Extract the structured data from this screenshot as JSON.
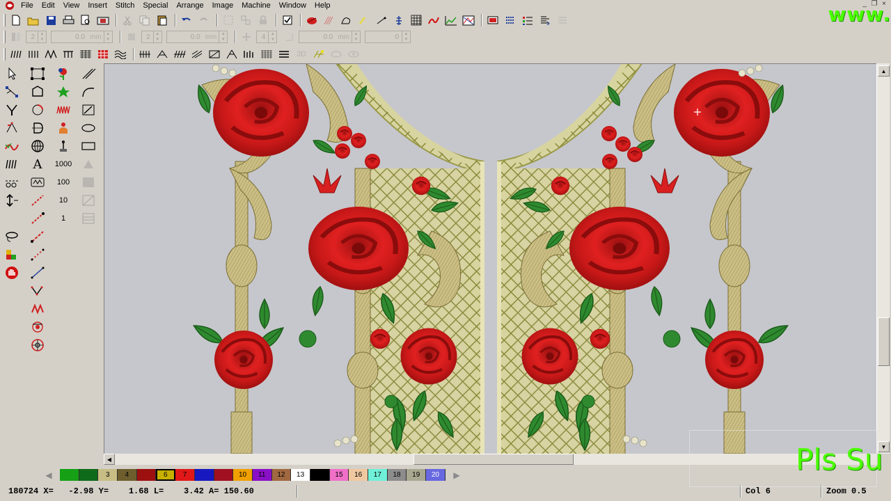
{
  "menubar": {
    "items": [
      "File",
      "Edit",
      "View",
      "Insert",
      "Stitch",
      "Special",
      "Arrange",
      "Image",
      "Machine",
      "Window",
      "Help"
    ],
    "window_controls": [
      "_",
      "❐",
      "×"
    ]
  },
  "watermarks": {
    "top": "www.",
    "bottom": "Pls Su"
  },
  "toolbar2": {
    "fields": [
      {
        "value": "0.0",
        "unit": "mm"
      },
      {
        "value": "0.0",
        "unit": "mm"
      },
      {
        "value": "0.0",
        "unit": "mm"
      },
      {
        "value": "0",
        "unit": ""
      }
    ],
    "small_values": [
      "2",
      "2",
      "4"
    ]
  },
  "toolbar3": {
    "label_3d": "3D"
  },
  "toolbox": {
    "text_tool": "A",
    "num_1000": "1000",
    "num_100": "100",
    "num_10": "10",
    "num_1": "1"
  },
  "colorbar": {
    "swatches": [
      {
        "label": "",
        "color": "#15a015",
        "fg": "#000"
      },
      {
        "label": "",
        "color": "#0f6a1a",
        "fg": "#000"
      },
      {
        "label": "3",
        "color": "#c8bd84",
        "fg": "#000"
      },
      {
        "label": "4",
        "color": "#6e5e2e",
        "fg": "#000"
      },
      {
        "label": "",
        "color": "#9c1010",
        "fg": "#000"
      },
      {
        "label": "6",
        "color": "#c8b000",
        "fg": "#000"
      },
      {
        "label": "7",
        "color": "#e01818",
        "fg": "#000"
      },
      {
        "label": "",
        "color": "#1818c0",
        "fg": "#000"
      },
      {
        "label": "",
        "color": "#a01020",
        "fg": "#000"
      },
      {
        "label": "10",
        "color": "#f0a000",
        "fg": "#000"
      },
      {
        "label": "11",
        "color": "#8a10c8",
        "fg": "#000"
      },
      {
        "label": "12",
        "color": "#a06840",
        "fg": "#000"
      },
      {
        "label": "13",
        "color": "#ffffff",
        "fg": "#000"
      },
      {
        "label": "",
        "color": "#000000",
        "fg": "#fff"
      },
      {
        "label": "15",
        "color": "#f070c8",
        "fg": "#000"
      },
      {
        "label": "16",
        "color": "#f0c8a0",
        "fg": "#000"
      },
      {
        "label": "17",
        "color": "#70f0d8",
        "fg": "#000"
      },
      {
        "label": "18",
        "color": "#8c8c8c",
        "fg": "#000"
      },
      {
        "label": "19",
        "color": "#a8a890",
        "fg": "#000"
      },
      {
        "label": "20",
        "color": "#6868e0",
        "fg": "#fff"
      }
    ],
    "selected_index": 5
  },
  "statusbar": {
    "coords": "180724 X=   -2.98 Y=    1.68 L=    3.42 A= 150.60",
    "col": "Col 6",
    "zoom": "Zoom 0.5"
  },
  "colors": {
    "canvas_bg": "#c6c7cc",
    "rose_red": "#d42020",
    "leaf_green": "#2a7a2a",
    "gold": "#c8bd84"
  }
}
